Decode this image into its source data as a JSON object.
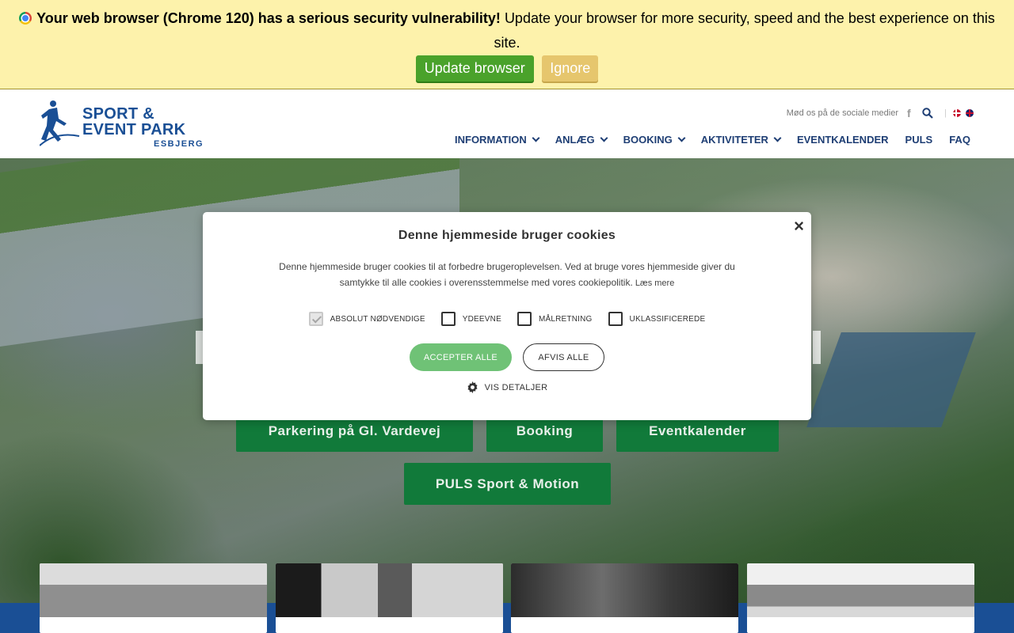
{
  "browser_update": {
    "headline": "Your web browser (Chrome 120) has a serious security vulnerability!",
    "message": "Update your browser for more security, speed and the best experience on this site.",
    "update_label": "Update browser",
    "ignore_label": "Ignore",
    "icon": "chrome-icon"
  },
  "header": {
    "logo_text_line1": "SPORT &",
    "logo_text_line2": "EVENT PARK",
    "logo_sub": "ESBJERG",
    "social_text": "Mød os på de sociale medier",
    "facebook_glyph": "f",
    "separator": "|",
    "nav": [
      {
        "label": "INFORMATION",
        "has_dropdown": true
      },
      {
        "label": "ANLÆG",
        "has_dropdown": true
      },
      {
        "label": "BOOKING",
        "has_dropdown": true
      },
      {
        "label": "AKTIVITETER",
        "has_dropdown": true
      },
      {
        "label": "EVENTKALENDER",
        "has_dropdown": false
      },
      {
        "label": "PULS",
        "has_dropdown": false
      },
      {
        "label": "FAQ",
        "has_dropdown": false
      }
    ]
  },
  "hero": {
    "buttons": [
      {
        "label": "Parkering på Gl. Vardevej"
      },
      {
        "label": "Booking"
      },
      {
        "label": "Eventkalender"
      },
      {
        "label": "PULS Sport & Motion"
      }
    ]
  },
  "cookie_modal": {
    "title": "Denne hjemmeside bruger cookies",
    "body": "Denne hjemmeside bruger cookies til at forbedre brugeroplevelsen. Ved at bruge vores hjemmeside giver du samtykke til alle cookies i overensstemmelse med vores cookiepolitik.",
    "read_more": "Læs mere",
    "close_glyph": "×",
    "categories": [
      {
        "label": "ABSOLUT NØDVENDIGE",
        "checked": true
      },
      {
        "label": "YDEEVNE",
        "checked": false
      },
      {
        "label": "MÅLRETNING",
        "checked": false
      },
      {
        "label": "UKLASSIFICEREDE",
        "checked": false
      }
    ],
    "accept_label": "ACCEPTER ALLE",
    "reject_label": "AFVIS ALLE",
    "details_label": "VIS DETALJER"
  },
  "colors": {
    "update_bar_bg": "#fdf2ab",
    "update_green": "#4aa22b",
    "nav_text": "#1e3e74",
    "brand_blue": "#1a4f95",
    "hero_button_green": "#117a3a",
    "accept_green": "#6fc276"
  }
}
